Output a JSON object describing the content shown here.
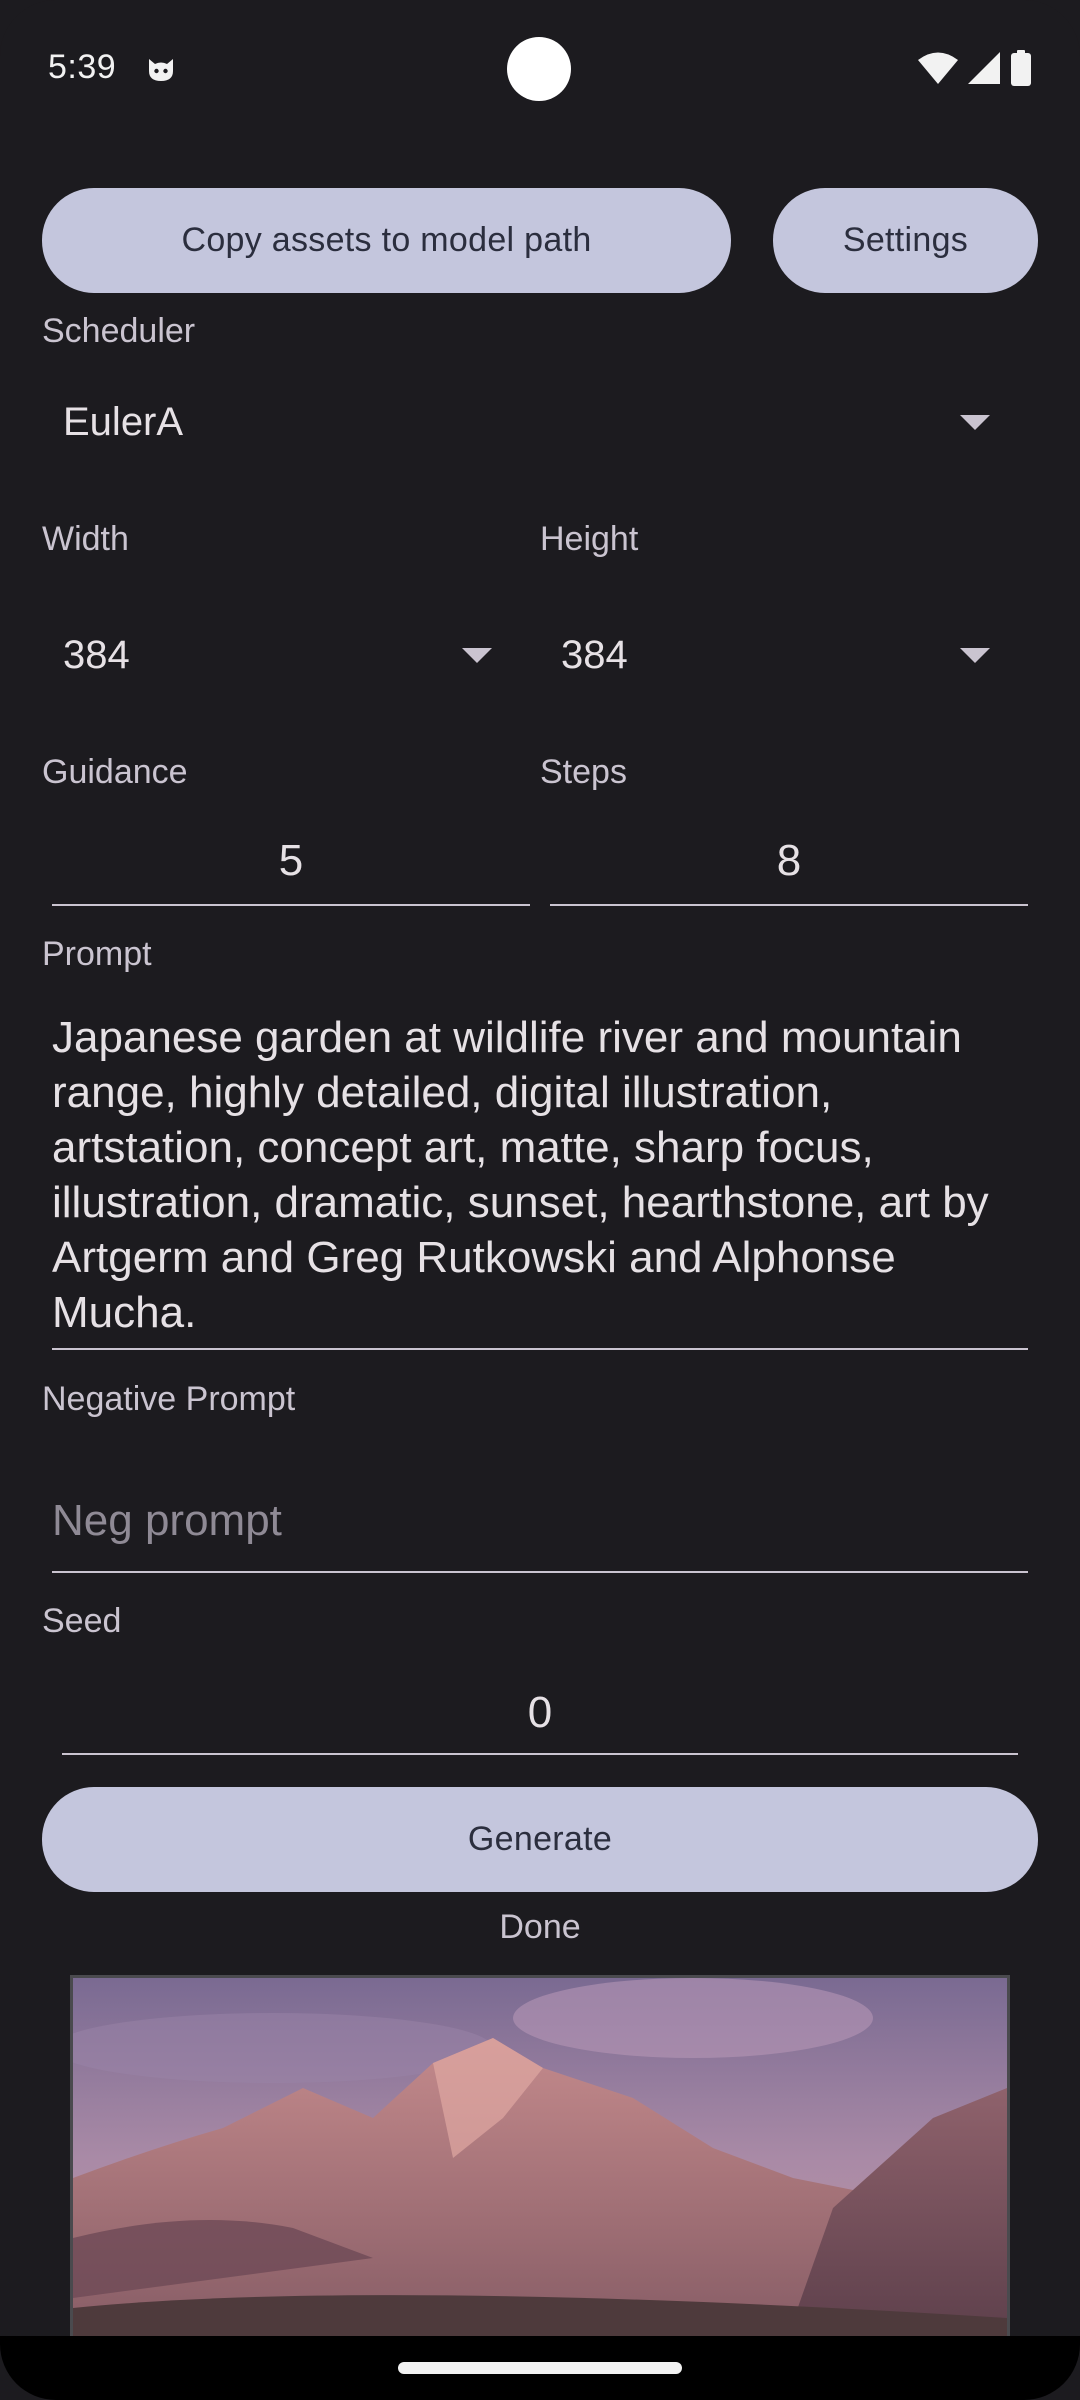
{
  "status_bar": {
    "time": "5:39"
  },
  "actions": {
    "copy_assets_label": "Copy assets to model path",
    "settings_label": "Settings",
    "generate_label": "Generate"
  },
  "scheduler": {
    "label": "Scheduler",
    "value": "EulerA"
  },
  "width": {
    "label": "Width",
    "value": "384"
  },
  "height": {
    "label": "Height",
    "value": "384"
  },
  "guidance": {
    "label": "Guidance",
    "value": "5"
  },
  "steps": {
    "label": "Steps",
    "value": "8"
  },
  "prompt": {
    "label": "Prompt",
    "value": "Japanese garden at wildlife river and mountain range, highly detailed, digital illustration, artstation, concept art, matte, sharp focus, illustration, dramatic, sunset, hearthstone, art by Artgerm and Greg Rutkowski and Alphonse Mucha."
  },
  "negative_prompt": {
    "label": "Negative Prompt",
    "placeholder": "Neg prompt"
  },
  "seed": {
    "label": "Seed",
    "value": "0"
  },
  "status": "Done",
  "icons": {
    "status_app": "cat-face-icon",
    "wifi": "wifi-icon",
    "signal": "cellular-signal-icon",
    "battery": "battery-icon",
    "dropdown": "dropdown-arrow-icon"
  },
  "colors": {
    "background": "#1c1b1f",
    "button": "#c4c6dd",
    "button_text": "#2b2e3e"
  }
}
